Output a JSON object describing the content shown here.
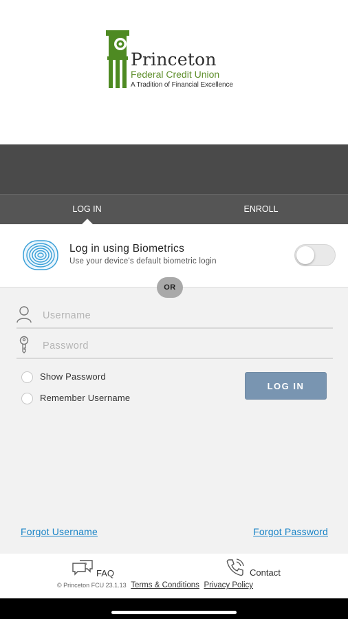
{
  "brand": {
    "name": "Princeton",
    "subtitle": "Federal Credit Union",
    "tagline": "A Tradition of Financial Excellence",
    "logo_icon": "column-icon",
    "green": "#4e8a22"
  },
  "tabs": [
    {
      "label": "LOG IN",
      "active": true
    },
    {
      "label": "ENROLL",
      "active": false
    }
  ],
  "biometrics": {
    "title": "Log in using Biometrics",
    "description": "Use your device's default biometric login",
    "icon": "fingerprint-icon",
    "enabled": false
  },
  "or_label": "OR",
  "form": {
    "username_placeholder": "Username",
    "password_placeholder": "Password",
    "show_password_label": "Show Password",
    "remember_username_label": "Remember Username",
    "login_button": "LOG IN"
  },
  "links": {
    "forgot_username": "Forgot Username",
    "forgot_password": "Forgot Password"
  },
  "footer": {
    "faq_label": "FAQ",
    "contact_label": "Contact",
    "version": "© Princeton FCU 23.1.13",
    "terms": "Terms & Conditions",
    "privacy": "Privacy Policy"
  },
  "colors": {
    "header_dark": "#4a4a4a",
    "tabs_bg": "#555555",
    "button_bg": "#7995b1",
    "link": "#1a84c7",
    "fingerprint": "#3aa0d8"
  }
}
